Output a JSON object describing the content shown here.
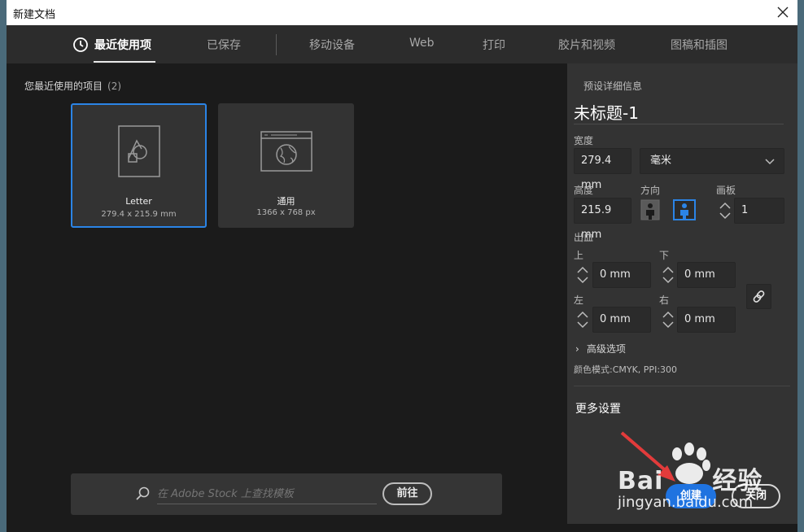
{
  "window": {
    "title": "新建文档"
  },
  "tabs": [
    {
      "label": "最近使用项",
      "active": true
    },
    {
      "label": "已保存"
    },
    {
      "label": "移动设备"
    },
    {
      "label": "Web"
    },
    {
      "label": "打印"
    },
    {
      "label": "胶片和视频"
    },
    {
      "label": "图稿和插图"
    }
  ],
  "recent": {
    "label": "您最近使用的项目",
    "count": "(2)",
    "items": [
      {
        "name": "Letter",
        "size": "279.4 x 215.9 mm",
        "selected": true,
        "icon": "shapes-document-icon"
      },
      {
        "name": "通用",
        "size": "1366 x 768 px",
        "icon": "web-globe-icon"
      }
    ]
  },
  "search": {
    "placeholder": "在 Adobe Stock 上查找模板",
    "go_label": "前往"
  },
  "preset": {
    "section_label": "预设详细信息",
    "title": "未标题-1",
    "width_label": "宽度",
    "width_value": "279.4 mm",
    "unit_value": "毫米",
    "height_label": "高度",
    "height_value": "215.9 mm",
    "orientation_label": "方向",
    "orientation_selected": "landscape",
    "artboards_label": "画板",
    "artboards_value": "1",
    "bleed_label": "出血",
    "bleed": {
      "top_label": "上",
      "top": "0 mm",
      "bottom_label": "下",
      "bottom": "0 mm",
      "left_label": "左",
      "left": "0 mm",
      "right_label": "右",
      "right": "0 mm"
    },
    "advanced_label": "高级选项",
    "color_mode": "颜色模式:CMYK, PPI:300",
    "more_settings": "更多设置",
    "create_label": "创建",
    "close_label": "关闭"
  },
  "watermark": {
    "brand_left": "Bai",
    "brand_right": "经验",
    "url": "jingyan.baidu.com"
  },
  "colors": {
    "accent": "#1f73e0",
    "selected_border": "#2b84e6",
    "bg": "#1b1b1b",
    "panel": "#333333"
  }
}
